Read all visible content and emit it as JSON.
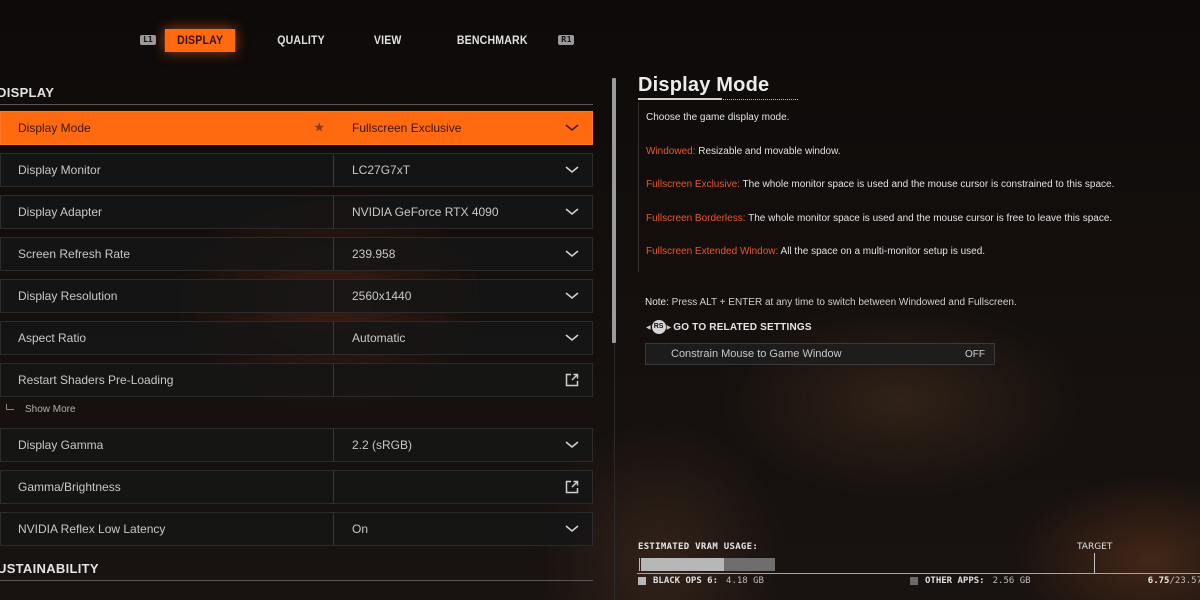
{
  "tabs": {
    "left_bumper": "L1",
    "right_bumper": "R1",
    "items": [
      {
        "label": "DISPLAY",
        "active": true
      },
      {
        "label": "QUALITY",
        "active": false
      },
      {
        "label": "VIEW",
        "active": false
      },
      {
        "label": "BENCHMARK",
        "active": false
      }
    ]
  },
  "sections": {
    "display_title": "DISPLAY",
    "sustainability_title": "USTAINABILITY"
  },
  "settings": [
    {
      "label": "Display Mode",
      "value": "Fullscreen Exclusive",
      "control": "dropdown",
      "favorite": true,
      "selected": true
    },
    {
      "label": "Display Monitor",
      "value": "LC27G7xT",
      "control": "dropdown"
    },
    {
      "label": "Display Adapter",
      "value": "NVIDIA GeForce RTX 4090",
      "control": "dropdown"
    },
    {
      "label": "Screen Refresh Rate",
      "value": "239.958",
      "control": "dropdown"
    },
    {
      "label": "Display Resolution",
      "value": "2560x1440",
      "control": "dropdown"
    },
    {
      "label": "Aspect Ratio",
      "value": "Automatic",
      "control": "dropdown"
    },
    {
      "label": "Restart Shaders Pre-Loading",
      "value": "",
      "control": "external"
    },
    {
      "label": "Display Gamma",
      "value": "2.2 (sRGB)",
      "control": "dropdown"
    },
    {
      "label": "Gamma/Brightness",
      "value": "",
      "control": "external"
    },
    {
      "label": "NVIDIA Reflex Low Latency",
      "value": "On",
      "control": "dropdown"
    }
  ],
  "show_more_label": "Show More",
  "favorite_icon": "star-icon",
  "detail": {
    "title": "Display Mode",
    "intro": "Choose the game display mode.",
    "options": [
      {
        "name": "Windowed:",
        "desc": " Resizable and movable window."
      },
      {
        "name": "Fullscreen Exclusive:",
        "desc": " The whole monitor space is used and the mouse cursor is constrained to this space."
      },
      {
        "name": "Fullscreen Borderless:",
        "desc": " The whole monitor space is used and the mouse cursor is free to leave this space."
      },
      {
        "name": "Fullscreen Extended Window:",
        "desc": " All the space on a multi-monitor setup is used."
      }
    ],
    "note_label": "Note:",
    "note_text": " Press ALT + ENTER at any time to switch between Windowed and Fullscreen.",
    "related_button": "RS",
    "related_label": "GO TO RELATED SETTINGS",
    "related_item": {
      "label": "Constrain Mouse to Game Window",
      "value": "OFF"
    }
  },
  "vram": {
    "title": "ESTIMATED VRAM USAGE:",
    "target_label": "TARGET",
    "game_label": "BLACK OPS 6:",
    "game_value": "4.18 GB",
    "game_gb": 4.18,
    "other_label": "OTHER APPS:",
    "other_value": "2.56 GB",
    "other_gb": 2.56,
    "used": "6.75",
    "separator": "/",
    "total": "23.57",
    "total_gb": 23.57,
    "colors": {
      "game": "#b7b7b7",
      "other": "#6e6e6e"
    }
  },
  "colors": {
    "accent": "#ff6a10",
    "highlight_text": "#e8582a"
  }
}
